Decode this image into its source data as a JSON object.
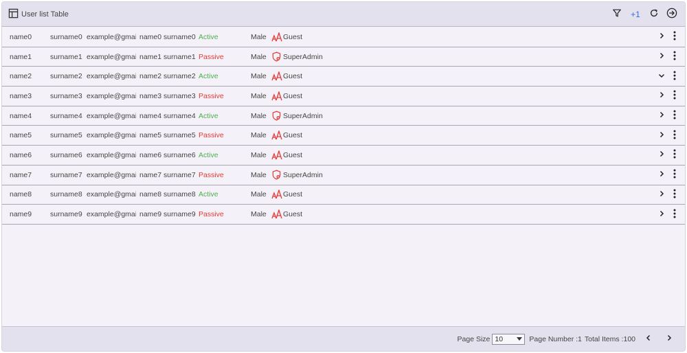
{
  "header": {
    "title": "User list Table",
    "extra_filters": "+1"
  },
  "rows": [
    {
      "name": "name0",
      "surname": "surname0",
      "email": "example@gmai",
      "full": "name0 surname0",
      "status": "Active",
      "gender": "Male",
      "role": "Guest"
    },
    {
      "name": "name1",
      "surname": "surname1",
      "email": "example@gmai",
      "full": "name1 surname1",
      "status": "Passive",
      "gender": "Male",
      "role": "SuperAdmin"
    },
    {
      "name": "name2",
      "surname": "surname2",
      "email": "example@gmai",
      "full": "name2 surname2",
      "status": "Active",
      "gender": "Male",
      "role": "Guest"
    },
    {
      "name": "name3",
      "surname": "surname3",
      "email": "example@gmai",
      "full": "name3 surname3",
      "status": "Passive",
      "gender": "Male",
      "role": "Guest"
    },
    {
      "name": "name4",
      "surname": "surname4",
      "email": "example@gmai",
      "full": "name4 surname4",
      "status": "Active",
      "gender": "Male",
      "role": "SuperAdmin"
    },
    {
      "name": "name5",
      "surname": "surname5",
      "email": "example@gmai",
      "full": "name5 surname5",
      "status": "Passive",
      "gender": "Male",
      "role": "Guest"
    },
    {
      "name": "name6",
      "surname": "surname6",
      "email": "example@gmai",
      "full": "name6 surname6",
      "status": "Active",
      "gender": "Male",
      "role": "Guest"
    },
    {
      "name": "name7",
      "surname": "surname7",
      "email": "example@gmai",
      "full": "name7 surname7",
      "status": "Passive",
      "gender": "Male",
      "role": "SuperAdmin"
    },
    {
      "name": "name8",
      "surname": "surname8",
      "email": "example@gmai",
      "full": "name8 surname8",
      "status": "Active",
      "gender": "Male",
      "role": "Guest"
    },
    {
      "name": "name9",
      "surname": "surname9",
      "email": "example@gmai",
      "full": "name9 surname9",
      "status": "Passive",
      "gender": "Male",
      "role": "Guest"
    }
  ],
  "expanded_row": 2,
  "footer": {
    "page_size_label": "Page Size",
    "page_size_value": "10",
    "page_number_text": "Page Number :1",
    "total_items_text": "Total Items :100"
  },
  "colors": {
    "active": "#4caf50",
    "passive": "#e53935",
    "accent": "#2f6fe0",
    "role_icon": "#e53935"
  },
  "icons": {
    "title": "table-icon",
    "filter": "filter-icon",
    "refresh": "refresh-icon",
    "export": "arrow-circle-right-icon",
    "guest": "font-size-icon",
    "superadmin": "shield-icon",
    "expand": "chevron-right-icon",
    "collapse": "chevron-down-icon",
    "menu": "more-vertical-icon",
    "prev": "chevron-left-icon",
    "next": "chevron-right-icon"
  }
}
